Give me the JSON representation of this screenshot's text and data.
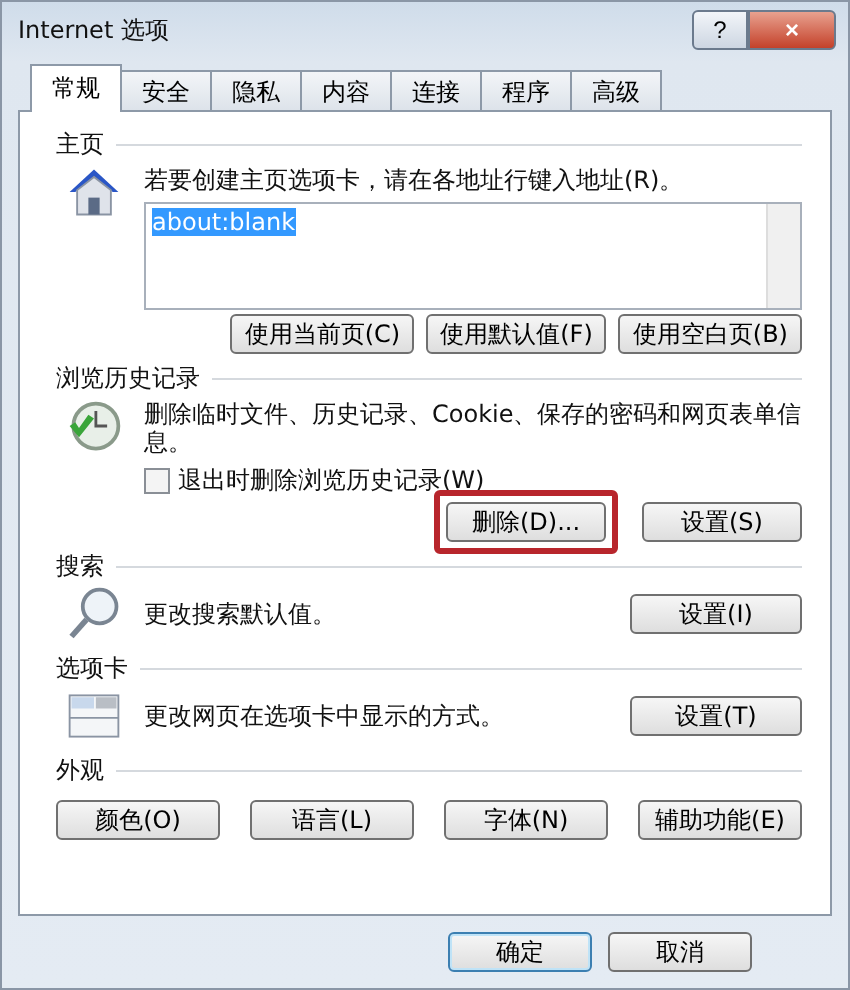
{
  "window": {
    "title": "Internet 选项",
    "help_button": "?",
    "close_button": "×"
  },
  "tabs": [
    {
      "label": "常规",
      "selected": true
    },
    {
      "label": "安全",
      "selected": false
    },
    {
      "label": "隐私",
      "selected": false
    },
    {
      "label": "内容",
      "selected": false
    },
    {
      "label": "连接",
      "selected": false
    },
    {
      "label": "程序",
      "selected": false
    },
    {
      "label": "高级",
      "selected": false
    }
  ],
  "homepage": {
    "heading": "主页",
    "instruction": "若要创建主页选项卡，请在各地址行键入地址(R)。",
    "address": "about:blank",
    "buttons": [
      "使用当前页(C)",
      "使用默认值(F)",
      "使用空白页(B)"
    ]
  },
  "history": {
    "heading": "浏览历史记录",
    "description": "删除临时文件、历史记录、Cookie、保存的密码和网页表单信息。",
    "delete_on_exit": {
      "label": "退出时删除浏览历史记录(W)",
      "checked": false
    },
    "delete_button": {
      "label": "删除(D)...",
      "highlighted": true
    },
    "settings_button": "设置(S)"
  },
  "search": {
    "heading": "搜索",
    "description": "更改搜索默认值。",
    "button": "设置(I)"
  },
  "tabs_section": {
    "heading": "选项卡",
    "description": "更改网页在选项卡中显示的方式。",
    "button": "设置(T)"
  },
  "appearance": {
    "heading": "外观",
    "buttons": [
      "颜色(O)",
      "语言(L)",
      "字体(N)",
      "辅助功能(E)"
    ]
  },
  "footer_buttons": [
    {
      "label": "确定",
      "default": true
    },
    {
      "label": "取消",
      "default": false
    }
  ]
}
